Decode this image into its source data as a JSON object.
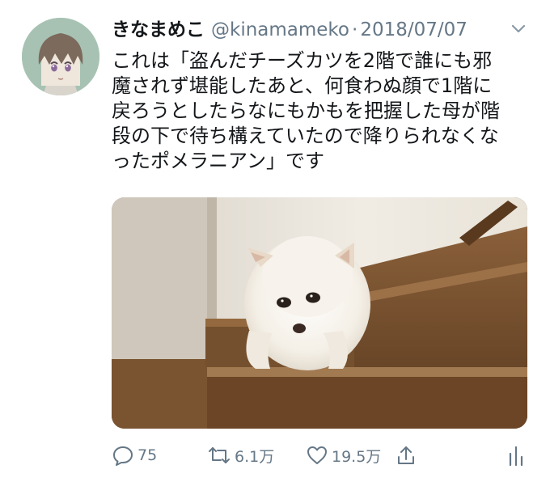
{
  "user": {
    "display_name": "きなまめこ",
    "handle": "@kinamameko",
    "separator": "·",
    "date": "2018/07/07"
  },
  "tweet": {
    "text": "これは「盗んだチーズカツを2階で誰にも邪\n魔されず堪能したあと、何食わぬ顔で1階に\n戻ろうとしたらなにもかもを把握した母が階\n段の下で待ち構えていたので降りられなくな\nったポメラニアン」です"
  },
  "icons": {
    "avatar": "anime-avatar",
    "caret": "chevron-down-icon",
    "reply": "reply-icon",
    "retweet": "retweet-icon",
    "like": "heart-icon",
    "share": "share-icon",
    "analytics": "analytics-icon"
  },
  "stats": {
    "replies": "75",
    "retweets": "6.1万",
    "likes": "19.5万"
  },
  "colors": {
    "text": "#14171a",
    "secondary": "#657786",
    "avatar_background": "#a7c2b3"
  }
}
